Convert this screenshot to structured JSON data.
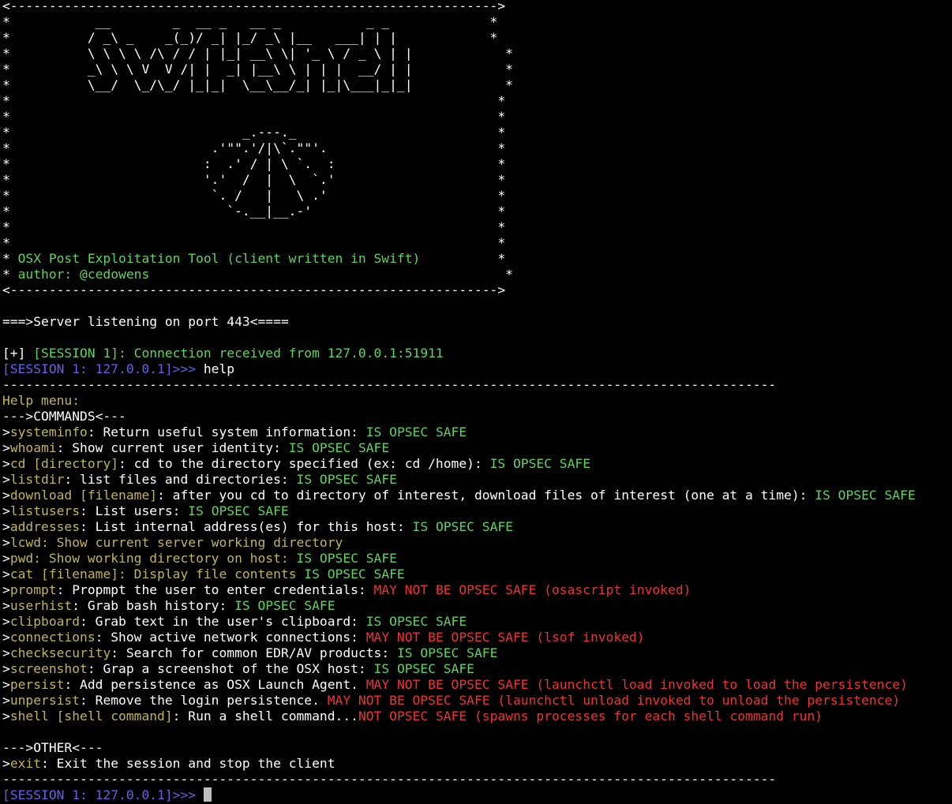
{
  "colors": {
    "background": "#000000",
    "text": "#ffffff",
    "green": "#5ed35e",
    "yellow": "#c0b45c",
    "red": "#ee3333",
    "blue": "#6460e8"
  },
  "lines": [
    [
      [
        "w",
        "<--------------------------------------------------------------->"
      ]
    ],
    [
      [
        "w",
        "*           __        _  __ _   __ _           _ _             *"
      ]
    ],
    [
      [
        "w",
        "*          / _\\ _    _(_)/ _| |_/ _\\ |__   ___| | |            *"
      ]
    ],
    [
      [
        "w",
        "*          \\ \\ \\ \\ /\\ / / | |_| __\\ \\| '_ \\ / _ \\ | |            *"
      ]
    ],
    [
      [
        "w",
        "*          _\\ \\ \\ V  V /| |  _| |__\\ \\ | | |  __/ | |            *"
      ]
    ],
    [
      [
        "w",
        "*          \\__/  \\_/\\_/ |_|_|  \\__\\__/_| |_|\\___|_|_|            *"
      ]
    ],
    [
      [
        "w",
        "*                                                               *"
      ]
    ],
    [
      [
        "w",
        "*                                                               *"
      ]
    ],
    [
      [
        "w",
        "*                              _.---._                          *"
      ]
    ],
    [
      [
        "w",
        "*                          .'\"\".'/|\\`.\"\"'.                      *"
      ]
    ],
    [
      [
        "w",
        "*                         :  .' / | \\ `.  :                     *"
      ]
    ],
    [
      [
        "w",
        "*                         '.'  /  |  \\  `.'                     *"
      ]
    ],
    [
      [
        "w",
        "*                          `. /   |   \\ .'                      *"
      ]
    ],
    [
      [
        "w",
        "*                            `-.__|__.-'                        *"
      ]
    ],
    [
      [
        "w",
        "*                                                               *"
      ]
    ],
    [
      [
        "w",
        "*                                                               *"
      ]
    ],
    [
      [
        "w",
        "* "
      ],
      [
        "g",
        "OSX Post Exploitation Tool (client written in Swift)"
      ],
      [
        "w",
        "          *"
      ]
    ],
    [
      [
        "w",
        "* "
      ],
      [
        "g",
        "author: @cedowens"
      ],
      [
        "w",
        "                                              *"
      ]
    ],
    [
      [
        "w",
        "<--------------------------------------------------------------->"
      ]
    ],
    [
      [
        "w",
        ""
      ]
    ],
    [
      [
        "w",
        "===>Server listening on port 443<===="
      ]
    ],
    [
      [
        "w",
        ""
      ]
    ],
    [
      [
        "w",
        "[+] "
      ],
      [
        "g",
        "[SESSION 1]: Connection received from 127.0.0.1:51911"
      ]
    ],
    [
      [
        "b",
        "[SESSION 1: 127.0.0.1]>>> "
      ],
      [
        "w",
        "help"
      ]
    ],
    [
      [
        "w",
        "----------------------------------------------------------------------------------------------------"
      ]
    ],
    [
      [
        "y",
        "Help menu:"
      ]
    ],
    [
      [
        "w",
        "--->COMMANDS<---"
      ]
    ],
    [
      [
        "w",
        ">"
      ],
      [
        "y",
        "systeminfo"
      ],
      [
        "w",
        ": Return useful system information: "
      ],
      [
        "g",
        "IS OPSEC SAFE"
      ]
    ],
    [
      [
        "w",
        ">"
      ],
      [
        "y",
        "whoami"
      ],
      [
        "w",
        ": Show current user identity: "
      ],
      [
        "g",
        "IS OPSEC SAFE"
      ]
    ],
    [
      [
        "w",
        ">"
      ],
      [
        "y",
        "cd [directory]"
      ],
      [
        "w",
        ": cd to the directory specified (ex: cd /home): "
      ],
      [
        "g",
        "IS OPSEC SAFE"
      ]
    ],
    [
      [
        "w",
        ">"
      ],
      [
        "y",
        "listdir"
      ],
      [
        "w",
        ": list files and directories: "
      ],
      [
        "g",
        "IS OPSEC SAFE"
      ]
    ],
    [
      [
        "w",
        ">"
      ],
      [
        "y",
        "download [filename]"
      ],
      [
        "w",
        ": after you cd to directory of interest, download files of interest (one at a time): "
      ],
      [
        "g",
        "IS OPSEC SAFE"
      ]
    ],
    [
      [
        "w",
        ">"
      ],
      [
        "y",
        "listusers"
      ],
      [
        "w",
        ": List users: "
      ],
      [
        "g",
        "IS OPSEC SAFE"
      ]
    ],
    [
      [
        "w",
        ">"
      ],
      [
        "y",
        "addresses"
      ],
      [
        "w",
        ": List internal address(es) for this host: "
      ],
      [
        "g",
        "IS OPSEC SAFE"
      ]
    ],
    [
      [
        "w",
        ">"
      ],
      [
        "y",
        "lcwd: Show current server working directory"
      ]
    ],
    [
      [
        "w",
        ">"
      ],
      [
        "y",
        "pwd: Show working directory on host: "
      ],
      [
        "g",
        "IS OPSEC SAFE"
      ]
    ],
    [
      [
        "w",
        ">"
      ],
      [
        "y",
        "cat [filename]: Display file contents "
      ],
      [
        "g",
        "IS OPSEC SAFE"
      ]
    ],
    [
      [
        "w",
        ">"
      ],
      [
        "y",
        "prompt"
      ],
      [
        "w",
        ": Propmpt the user to enter credentials: "
      ],
      [
        "r",
        "MAY NOT BE OPSEC SAFE (osascript invoked)"
      ]
    ],
    [
      [
        "w",
        ">"
      ],
      [
        "y",
        "userhist"
      ],
      [
        "w",
        ": Grab bash history: "
      ],
      [
        "g",
        "IS OPSEC SAFE"
      ]
    ],
    [
      [
        "w",
        ">"
      ],
      [
        "y",
        "clipboard"
      ],
      [
        "w",
        ": Grab text in the user's clipboard: "
      ],
      [
        "g",
        "IS OPSEC SAFE"
      ]
    ],
    [
      [
        "w",
        ">"
      ],
      [
        "y",
        "connections"
      ],
      [
        "w",
        ": Show active network connections: "
      ],
      [
        "r",
        "MAY NOT BE OPSEC SAFE (lsof invoked)"
      ]
    ],
    [
      [
        "w",
        ">"
      ],
      [
        "y",
        "checksecurity"
      ],
      [
        "w",
        ": Search for common EDR/AV products: "
      ],
      [
        "g",
        "IS OPSEC SAFE"
      ]
    ],
    [
      [
        "w",
        ">"
      ],
      [
        "y",
        "screenshot"
      ],
      [
        "w",
        ": Grap a screenshot of the OSX host: "
      ],
      [
        "g",
        "IS OPSEC SAFE"
      ]
    ],
    [
      [
        "w",
        ">"
      ],
      [
        "y",
        "persist"
      ],
      [
        "w",
        ": Add persistence as OSX Launch Agent. "
      ],
      [
        "r",
        "MAY NOT BE OPSEC SAFE (launchctl load invoked to load the persistence)"
      ]
    ],
    [
      [
        "w",
        ">"
      ],
      [
        "y",
        "unpersist"
      ],
      [
        "w",
        ": Remove the login persistence. "
      ],
      [
        "r",
        "MAY NOT BE OPSEC SAFE (launchctl unload invoked to unload the persistence)"
      ]
    ],
    [
      [
        "w",
        ">"
      ],
      [
        "y",
        "shell [shell command]"
      ],
      [
        "w",
        ": Run a shell command..."
      ],
      [
        "r",
        "NOT OPSEC SAFE (spawns processes for each shell command run)"
      ]
    ],
    [
      [
        "w",
        ""
      ]
    ],
    [
      [
        "w",
        "--->OTHER<---"
      ]
    ],
    [
      [
        "w",
        ">"
      ],
      [
        "y",
        "exit"
      ],
      [
        "w",
        ": Exit the session and stop the client"
      ]
    ],
    [
      [
        "w",
        "----------------------------------------------------------------------------------------------------"
      ]
    ],
    [
      [
        "b",
        "[SESSION 1: 127.0.0.1]>>> "
      ]
    ]
  ]
}
